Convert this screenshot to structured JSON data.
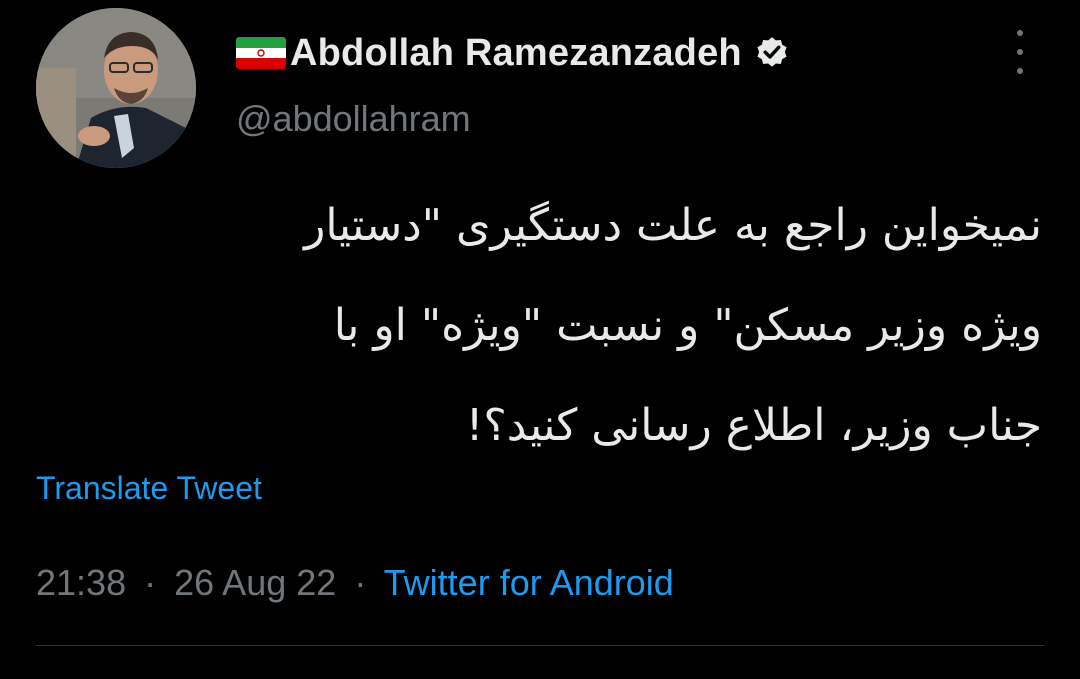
{
  "user": {
    "display_name": "Abdollah Ramezanzadeh",
    "handle": "@abdollahram",
    "flag_icon": "iran-flag-icon",
    "verified_icon": "verified-badge-icon"
  },
  "tweet": {
    "lines": [
      "نمیخواین راجع به علت دستگیری \"دستیار",
      "ویژه وزیر مسکن\" و نسبت \"ویژه\" او با",
      "جناب وزیر، اطلاع رسانی کنید؟!"
    ],
    "translate_label": "Translate Tweet"
  },
  "meta": {
    "time": "21:38",
    "date": "26 Aug 22",
    "separator": "·",
    "source": "Twitter for Android"
  },
  "colors": {
    "background": "#000000",
    "text": "#e7e9ea",
    "secondary": "#71767b",
    "link": "#1d9bf0",
    "divider": "#2f3336"
  }
}
